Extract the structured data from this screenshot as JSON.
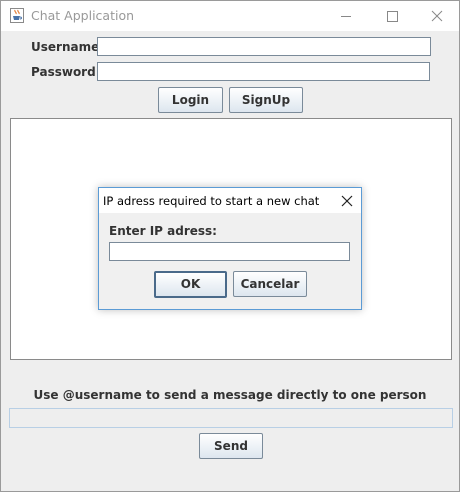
{
  "window": {
    "title": "Chat Application"
  },
  "login": {
    "username_label": "Username:",
    "username_value": "",
    "password_label": "Password:",
    "password_value": "",
    "login_button": "Login",
    "signup_button": "SignUp"
  },
  "chat": {
    "messages": "",
    "hint": "Use @username to send a message directly to one person",
    "message_value": "",
    "send_button": "Send"
  },
  "dialog": {
    "title": "IP adress required to start a new chat",
    "prompt": "Enter IP adress:",
    "ip_value": "",
    "ok_button": "OK",
    "cancel_button": "Cancelar"
  },
  "icons": {
    "app": "java-cup-icon",
    "minimize": "minimize-icon",
    "maximize": "maximize-icon",
    "close": "close-icon",
    "dialog_close": "close-icon"
  },
  "colors": {
    "window_bg": "#eeeeee",
    "dialog_border": "#5b9bd5",
    "button_border": "#7a8a99",
    "ok_focus_border": "#4a6a8a"
  }
}
